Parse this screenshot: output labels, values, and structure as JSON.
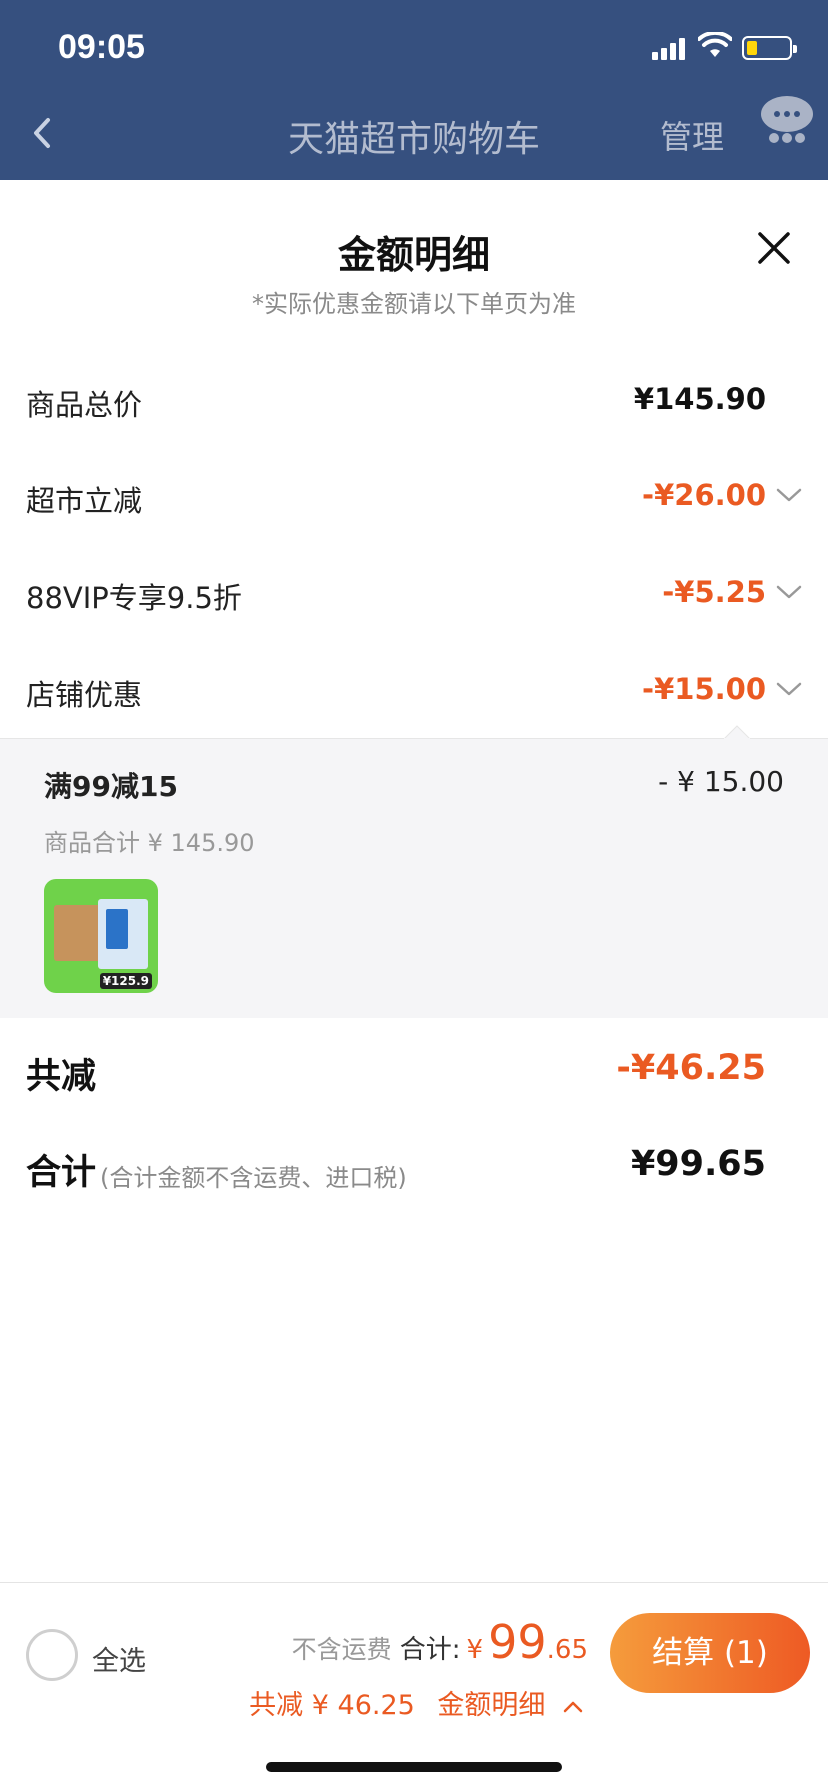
{
  "status_bar": {
    "time": "09:05"
  },
  "navbar": {
    "title": "天猫超市购物车",
    "manage": "管理"
  },
  "sheet": {
    "title": "金额明细",
    "subtitle": "*实际优惠金额请以下单页为准",
    "rows": [
      {
        "label": "商品总价",
        "value": "¥145.90",
        "discount": false,
        "expandable": false
      },
      {
        "label": "超市立减",
        "value": "-¥26.00",
        "discount": true,
        "expandable": true
      },
      {
        "label": "88VIP专享9.5折",
        "value": "-¥5.25",
        "discount": true,
        "expandable": true
      },
      {
        "label": "店铺优惠",
        "value": "-¥15.00",
        "discount": true,
        "expandable": true
      }
    ],
    "shop_discount_detail": {
      "title": "满99减15",
      "amount": "- ¥ 15.00",
      "subtotal": "商品合计 ¥ 145.90",
      "thumb_price_tag": "¥125.9"
    },
    "total_discount": {
      "label": "共减",
      "value": "-¥46.25"
    },
    "total": {
      "label": "合计",
      "note": "(合计金额不含运费、进口税)",
      "value": "¥99.65"
    }
  },
  "bottom_bar": {
    "select_all": "全选",
    "no_shipping": "不含运费",
    "total_label": "合计:",
    "yen": "¥",
    "total_int": "99",
    "total_dec": ".65",
    "discount_text": "共减 ¥ 46.25",
    "detail_link": "金额明细",
    "checkout": "结算 (1)"
  },
  "colors": {
    "accent": "#ea5a22",
    "header": "#36507f"
  }
}
